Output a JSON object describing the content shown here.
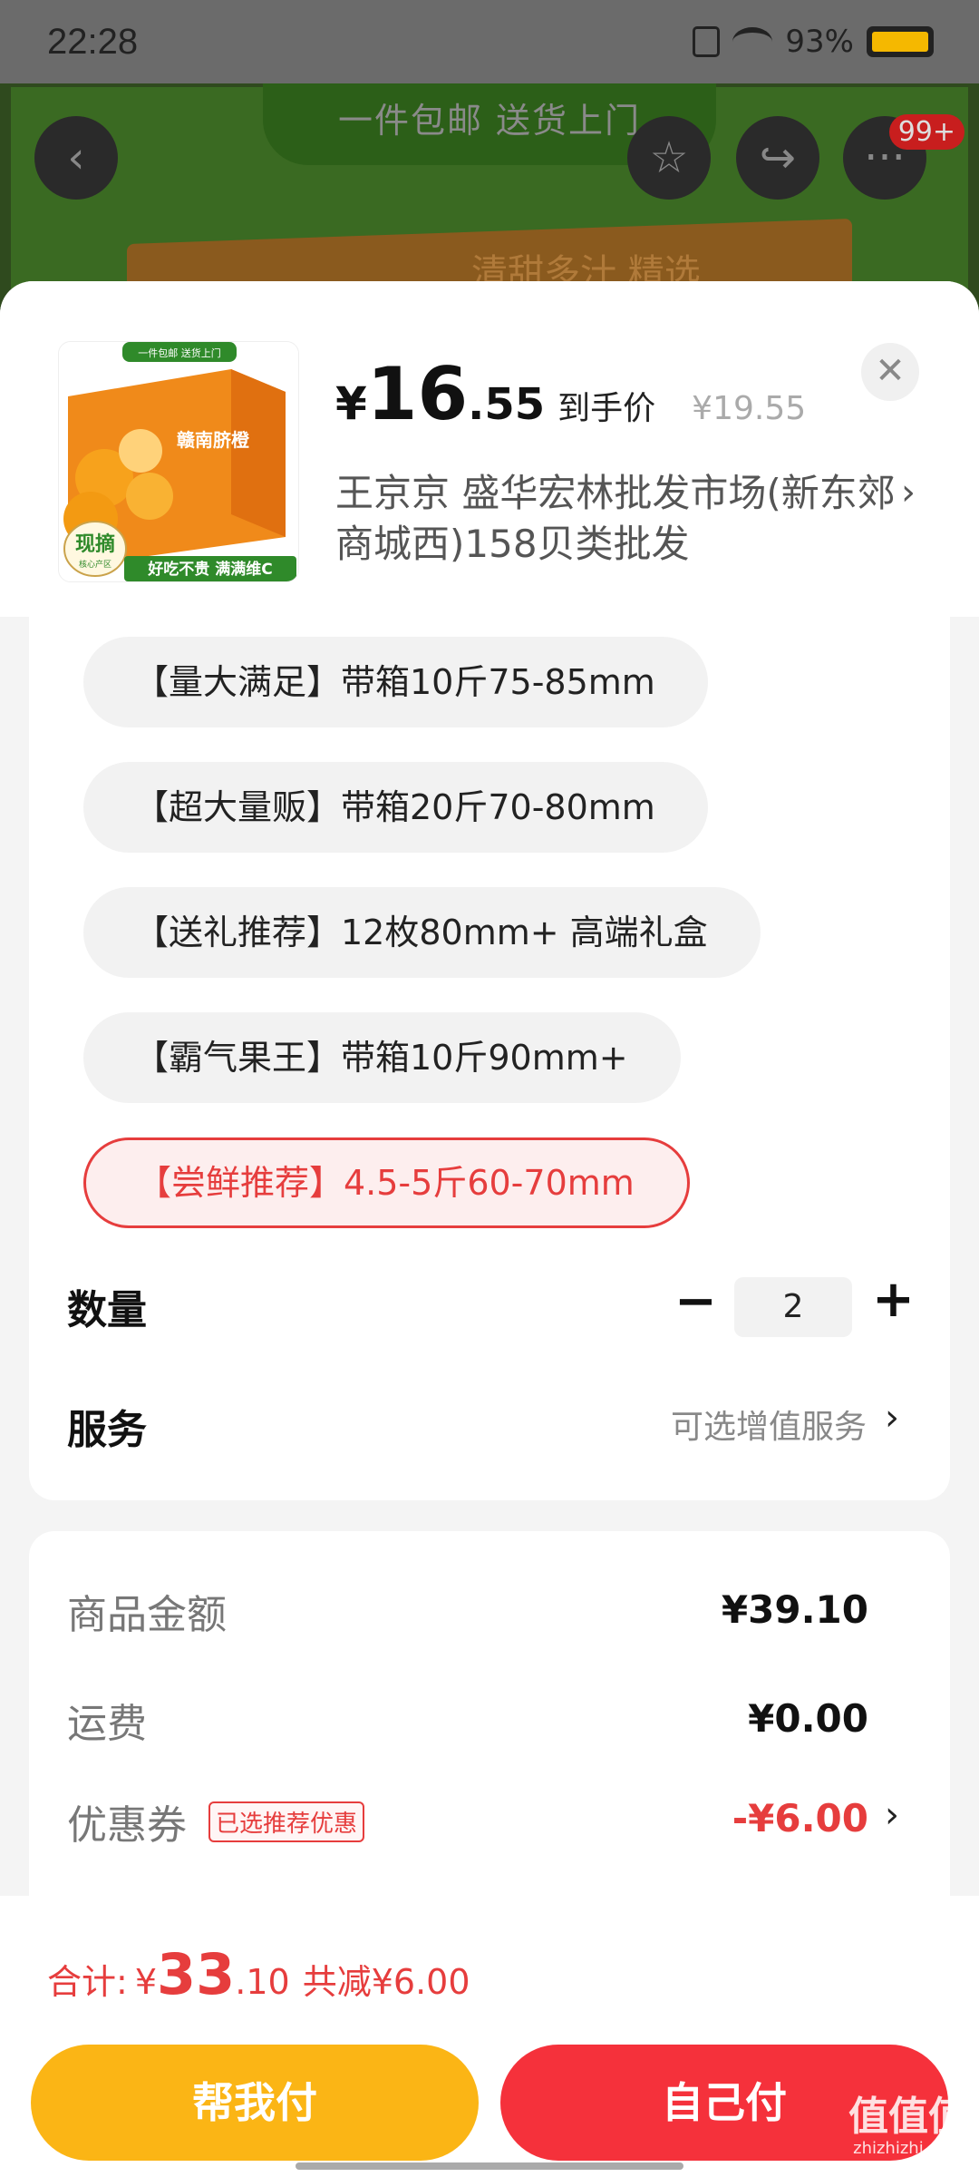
{
  "status_bar": {
    "time": "22:28",
    "battery": "93%"
  },
  "background_page": {
    "banner_text": "一件包邮  送货上门",
    "box_text": "清甜多汁 精选",
    "badge": "99+"
  },
  "product": {
    "price_yen": "¥",
    "price_int": "16",
    "price_dec": ".55",
    "price_label": "到手价",
    "original_price": "¥19.55",
    "seller": "王京京  盛华宏林批发市场(新东郊商城西)158贝类批发",
    "thumb": {
      "top_text": "一件包邮  送货上门",
      "brand": "赣南脐橙",
      "stamp": "现摘",
      "stamp_sub": "核心产区",
      "slogan": "好吃不贵 满满维C"
    }
  },
  "options": [
    {
      "label": "【量大满足】带箱10斤75-85mm",
      "selected": false
    },
    {
      "label": "【超大量贩】带箱20斤70-80mm",
      "selected": false
    },
    {
      "label": "【送礼推荐】12枚80mm+ 高端礼盒",
      "selected": false
    },
    {
      "label": "【霸气果王】带箱10斤90mm+",
      "selected": false
    },
    {
      "label": "【尝鲜推荐】4.5-5斤60-70mm",
      "selected": true
    }
  ],
  "quantity": {
    "label": "数量",
    "value": "2",
    "minus": "−",
    "plus": "+"
  },
  "service": {
    "label": "服务",
    "value": "可选增值服务"
  },
  "summary": {
    "goods_label": "商品金额",
    "goods_value": "¥39.10",
    "shipping_label": "运费",
    "shipping_value": "¥0.00",
    "coupon_label": "优惠券",
    "coupon_tag": "已选推荐优惠",
    "coupon_value": "-¥6.00"
  },
  "footer": {
    "total_label": "合计:",
    "total_yen": "¥",
    "total_int": "33",
    "total_dec": ".10",
    "total_reduce": "共减¥6.00",
    "help_pay": "帮我付",
    "self_pay": "自己付"
  },
  "watermark": {
    "main": "值值值",
    "sub": "zhizhizhi.com"
  },
  "colors": {
    "accent_red": "#e63d3d",
    "pay_yellow": "#fbb515",
    "pay_red": "#f5313b"
  },
  "icons": [
    "back-icon",
    "star-icon",
    "share-icon",
    "more-icon",
    "close-icon",
    "chevron-right-icon"
  ]
}
